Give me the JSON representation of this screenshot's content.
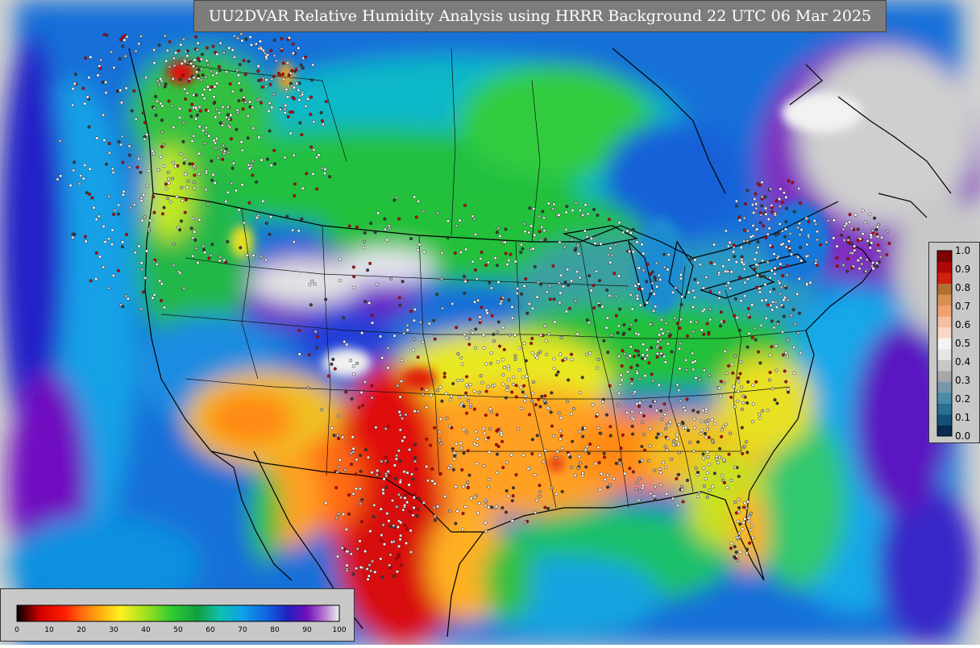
{
  "title": "UU2DVAR Relative Humidity Analysis using HRRR Background 22 UTC 06 Mar 2025",
  "rh_colorbar": {
    "ticks": [
      "0",
      "10",
      "20",
      "30",
      "40",
      "50",
      "60",
      "70",
      "80",
      "90",
      "100"
    ],
    "min": 0,
    "max": 100
  },
  "weight_colorbar": {
    "ticks": [
      "0.0",
      "0.1",
      "0.2",
      "0.3",
      "0.4",
      "0.5",
      "0.6",
      "0.7",
      "0.8",
      "0.9",
      "1.0"
    ],
    "min": 0,
    "max": 1
  },
  "colors": {
    "ocean_blue": "#1e7fe0",
    "land_green": "#22c43a",
    "dry_red": "#e10b0b",
    "dry_orange": "#ff9a18",
    "yellow": "#f2f21e",
    "moist_purple": "#8a0cbd",
    "saturated_white": "#e8e8e8",
    "no_data_gray": "#d2d2d2"
  }
}
